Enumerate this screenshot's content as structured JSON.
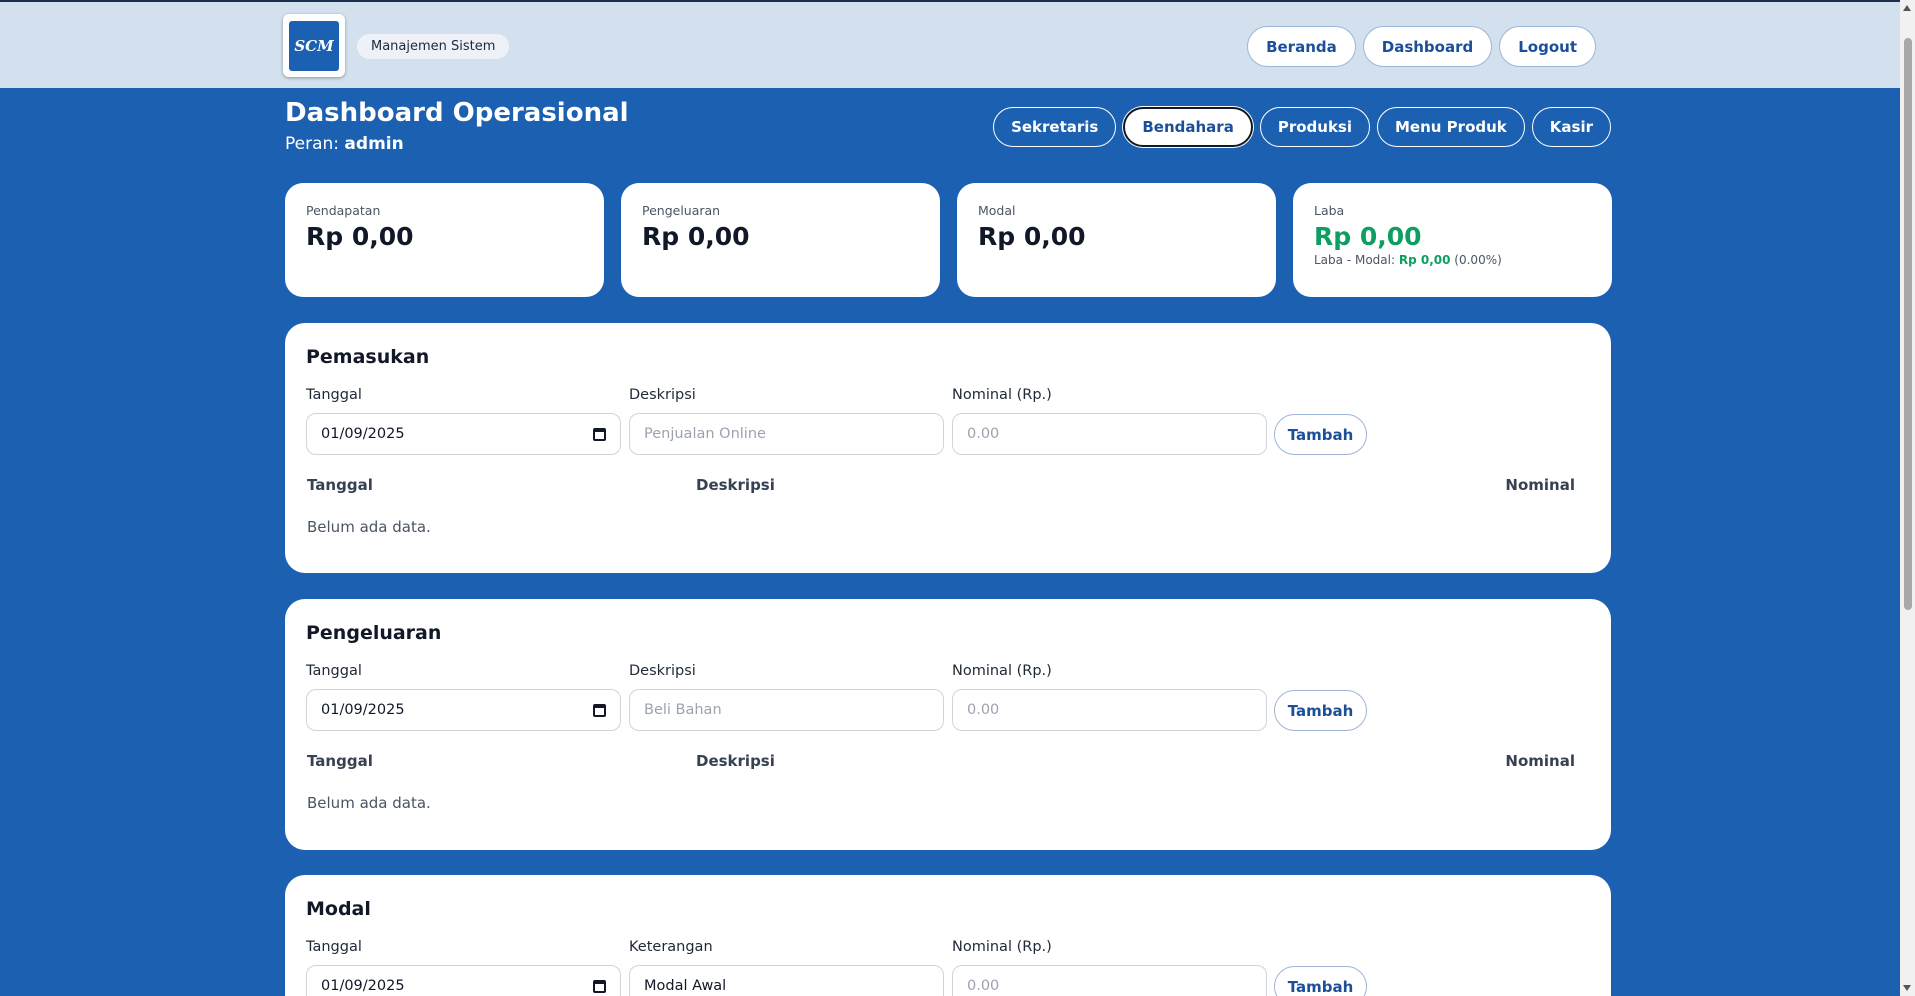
{
  "header": {
    "logo_text": "SCM",
    "brand": "Manajemen Sistem",
    "nav": [
      "Beranda",
      "Dashboard",
      "Logout"
    ]
  },
  "page": {
    "title": "Dashboard Operasional",
    "role_label": "Peran:",
    "role_value": "admin"
  },
  "tabs": {
    "items": [
      "Sekretaris",
      "Bendahara",
      "Produksi",
      "Menu Produk",
      "Kasir"
    ],
    "active": "Bendahara"
  },
  "stats": {
    "pendapatan": {
      "label": "Pendapatan",
      "value": "Rp 0,00"
    },
    "pengeluaran": {
      "label": "Pengeluaran",
      "value": "Rp 0,00"
    },
    "modal": {
      "label": "Modal",
      "value": "Rp 0,00"
    },
    "laba": {
      "label": "Laba",
      "value": "Rp 0,00",
      "sub_prefix": "Laba - Modal:",
      "sub_value": "Rp 0,00",
      "sub_pct": "(0.00%)"
    }
  },
  "pemasukan": {
    "title": "Pemasukan",
    "date_label": "Tanggal",
    "date_value": "01/09/2025",
    "desc_label": "Deskripsi",
    "desc_placeholder": "Penjualan Online",
    "nominal_label": "Nominal (Rp.)",
    "nominal_placeholder": "0.00",
    "add_label": "Tambah",
    "columns": [
      "Tanggal",
      "Deskripsi",
      "Nominal"
    ],
    "empty": "Belum ada data."
  },
  "pengeluaran": {
    "title": "Pengeluaran",
    "date_label": "Tanggal",
    "date_value": "01/09/2025",
    "desc_label": "Deskripsi",
    "desc_placeholder": "Beli Bahan",
    "nominal_label": "Nominal (Rp.)",
    "nominal_placeholder": "0.00",
    "add_label": "Tambah",
    "columns": [
      "Tanggal",
      "Deskripsi",
      "Nominal"
    ],
    "empty": "Belum ada data."
  },
  "modal": {
    "title": "Modal",
    "date_label": "Tanggal",
    "date_value": "01/09/2025",
    "desc_label": "Keterangan",
    "desc_value": "Modal Awal",
    "nominal_label": "Nominal (Rp.)",
    "nominal_placeholder": "0.00",
    "add_label": "Tambah"
  },
  "colors": {
    "primary": "#1c61b1",
    "header_bg": "#d3e0ee",
    "accent_text": "#1c4f99",
    "profit_green": "#0e9e62"
  }
}
